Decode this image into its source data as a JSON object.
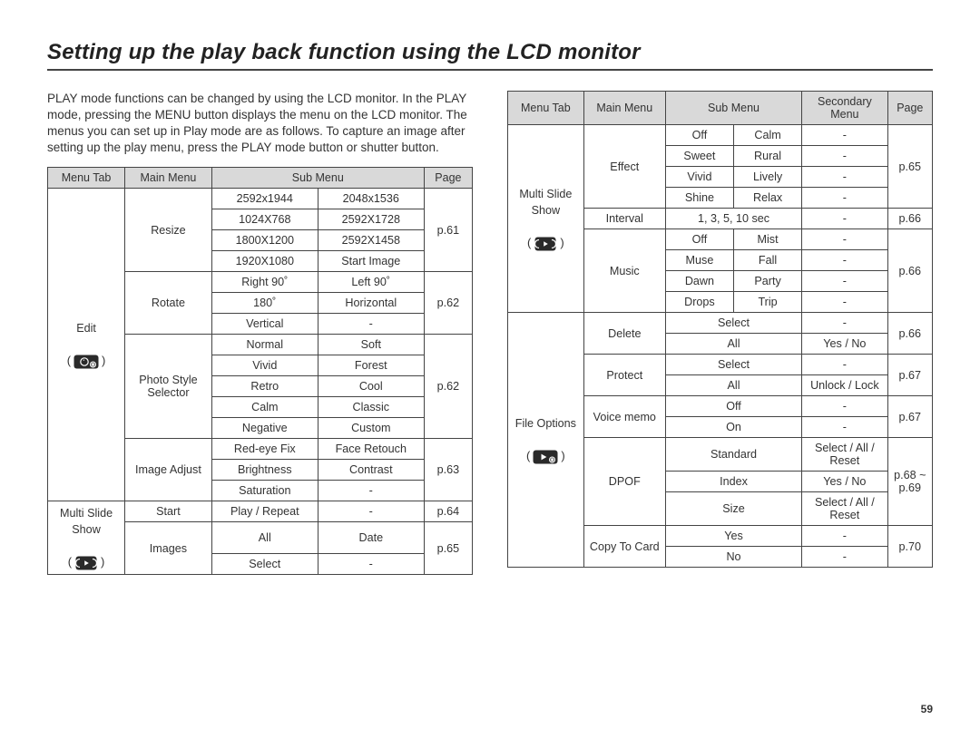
{
  "page_number": "59",
  "heading": "Setting up the play back function using the LCD monitor",
  "intro": "PLAY mode functions can be changed by using the LCD monitor. In the PLAY mode, pressing the MENU button displays the menu on the LCD monitor. The menus you can set up in Play mode are as follows. To capture an image after setting up the play menu, press the PLAY mode button or shutter button.",
  "left": {
    "headers": {
      "tab": "Menu Tab",
      "main": "Main Menu",
      "sub": "Sub Menu",
      "page": "Page"
    },
    "tab_edit": "Edit",
    "tab_slide": "Multi Slide Show",
    "resize": {
      "label": "Resize",
      "r1a": "2592x1944",
      "r1b": "2048x1536",
      "r2a": "1024X768",
      "r2b": "2592X1728",
      "r3a": "1800X1200",
      "r3b": "2592X1458",
      "r4a": "1920X1080",
      "r4b": "Start Image",
      "page": "p.61"
    },
    "rotate": {
      "label": "Rotate",
      "r1a": "Right 90˚",
      "r1b": "Left 90˚",
      "r2a": "180˚",
      "r2b": "Horizontal",
      "r3a": "Vertical",
      "r3b": "-",
      "page": "p.62"
    },
    "style": {
      "label": "Photo Style Selector",
      "r1a": "Normal",
      "r1b": "Soft",
      "r2a": "Vivid",
      "r2b": "Forest",
      "r3a": "Retro",
      "r3b": "Cool",
      "r4a": "Calm",
      "r4b": "Classic",
      "r5a": "Negative",
      "r5b": "Custom",
      "page": "p.62"
    },
    "adjust": {
      "label": "Image Adjust",
      "r1a": "Red-eye Fix",
      "r1b": "Face Retouch",
      "r2a": "Brightness",
      "r2b": "Contrast",
      "r3a": "Saturation",
      "r3b": "-",
      "page": "p.63"
    },
    "start": {
      "label": "Start",
      "a": "Play / Repeat",
      "b": "-",
      "page": "p.64"
    },
    "images": {
      "label": "Images",
      "r1a": "All",
      "r1b": "Date",
      "r2a": "Select",
      "r2b": "-",
      "page": "p.65"
    }
  },
  "right": {
    "headers": {
      "tab": "Menu Tab",
      "main": "Main Menu",
      "sub": "Sub Menu",
      "sec": "Secondary Menu",
      "page": "Page"
    },
    "tab_slide": "Multi Slide Show",
    "tab_file": "File Options",
    "effect": {
      "label": "Effect",
      "r1a": "Off",
      "r1b": "Calm",
      "r1c": "-",
      "r2a": "Sweet",
      "r2b": "Rural",
      "r2c": "-",
      "r3a": "Vivid",
      "r3b": "Lively",
      "r3c": "-",
      "r4a": "Shine",
      "r4b": "Relax",
      "r4c": "-",
      "page": "p.65"
    },
    "interval": {
      "label": "Interval",
      "a": "1, 3, 5, 10 sec",
      "c": "-",
      "page": "p.66"
    },
    "music": {
      "label": "Music",
      "r1a": "Off",
      "r1b": "Mist",
      "r1c": "-",
      "r2a": "Muse",
      "r2b": "Fall",
      "r2c": "-",
      "r3a": "Dawn",
      "r3b": "Party",
      "r3c": "-",
      "r4a": "Drops",
      "r4b": "Trip",
      "r4c": "-",
      "page": "p.66"
    },
    "delete": {
      "label": "Delete",
      "r1a": "Select",
      "r1c": "-",
      "r2a": "All",
      "r2c": "Yes / No",
      "page": "p.66"
    },
    "protect": {
      "label": "Protect",
      "r1a": "Select",
      "r1c": "-",
      "r2a": "All",
      "r2c": "Unlock / Lock",
      "page": "p.67"
    },
    "voice": {
      "label": "Voice memo",
      "r1a": "Off",
      "r1c": "-",
      "r2a": "On",
      "r2c": "-",
      "page": "p.67"
    },
    "dpof": {
      "label": "DPOF",
      "r1a": "Standard",
      "r1c": "Select / All / Reset",
      "r2a": "Index",
      "r2c": "Yes / No",
      "r3a": "Size",
      "r3c": "Select / All / Reset",
      "page": "p.68 ~ p.69"
    },
    "copy": {
      "label": "Copy To Card",
      "r1a": "Yes",
      "r1c": "-",
      "r2a": "No",
      "r2c": "-",
      "page": "p.70"
    }
  }
}
